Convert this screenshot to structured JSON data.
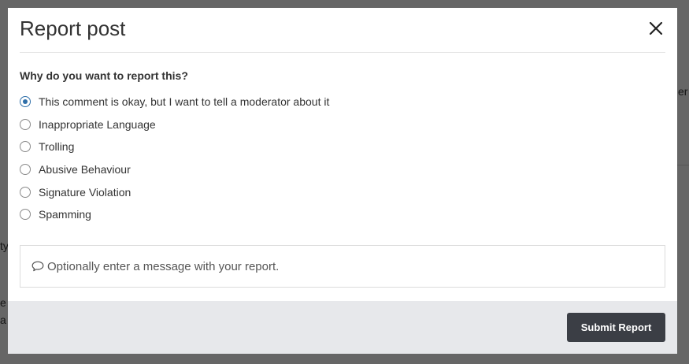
{
  "modal": {
    "title": "Report post",
    "question": "Why do you want to report this?",
    "reasons": [
      {
        "label": "This comment is okay, but I want to tell a moderator about it",
        "selected": true
      },
      {
        "label": "Inappropriate Language",
        "selected": false
      },
      {
        "label": "Trolling",
        "selected": false
      },
      {
        "label": "Abusive Behaviour",
        "selected": false
      },
      {
        "label": "Signature Violation",
        "selected": false
      },
      {
        "label": "Spamming",
        "selected": false
      }
    ],
    "message_placeholder": "Optionally enter a message with your report.",
    "submit_label": "Submit Report"
  },
  "background": {
    "fragments": [
      "er",
      "ty",
      "e r",
      "a"
    ]
  },
  "icons": {
    "close": "close-icon",
    "message": "speech-bubble-icon"
  },
  "colors": {
    "accent": "#2f6fa9",
    "submit_button": "#3b3e45",
    "footer": "#e7e8eb"
  }
}
